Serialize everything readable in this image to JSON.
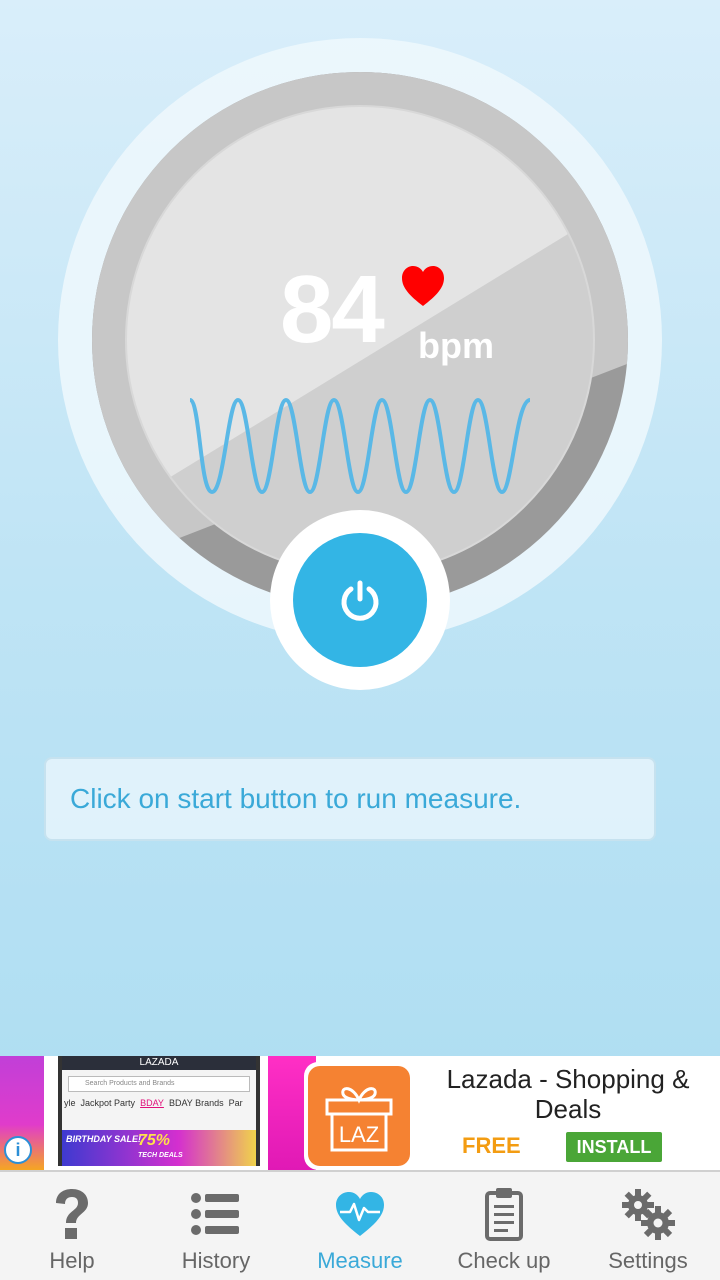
{
  "measurement": {
    "bpm_value": "84",
    "bpm_unit": "bpm",
    "status_message": "Click on start button to run measure."
  },
  "ad": {
    "thumbnail": {
      "store_name": "LAZADA",
      "search_placeholder": "Search Products and Brands",
      "categories": [
        "yle",
        "Jackpot Party",
        "BDAY",
        "BDAY Brands",
        "Par"
      ],
      "promo_text": "BIRTHDAY SALE!",
      "discount_text": "75%",
      "deals_text": "TECH DEALS"
    },
    "app_icon_text": "LAZ",
    "app_name": "Lazada - Shopping & Deals",
    "price": "FREE",
    "install_label": "INSTALL",
    "info_glyph": "i"
  },
  "nav": {
    "items": [
      {
        "label": "Help",
        "icon": "question-icon"
      },
      {
        "label": "History",
        "icon": "list-icon"
      },
      {
        "label": "Measure",
        "icon": "heart-pulse-icon"
      },
      {
        "label": "Check up",
        "icon": "clipboard-icon"
      },
      {
        "label": "Settings",
        "icon": "gears-icon"
      }
    ],
    "active": "Measure"
  },
  "colors": {
    "accent": "#33b5e5",
    "heart": "#ff0000",
    "text_accent": "#3aa9d8",
    "install_green": "#4aa637",
    "free_orange": "#f39c12",
    "ad_icon_orange": "#f58232"
  }
}
